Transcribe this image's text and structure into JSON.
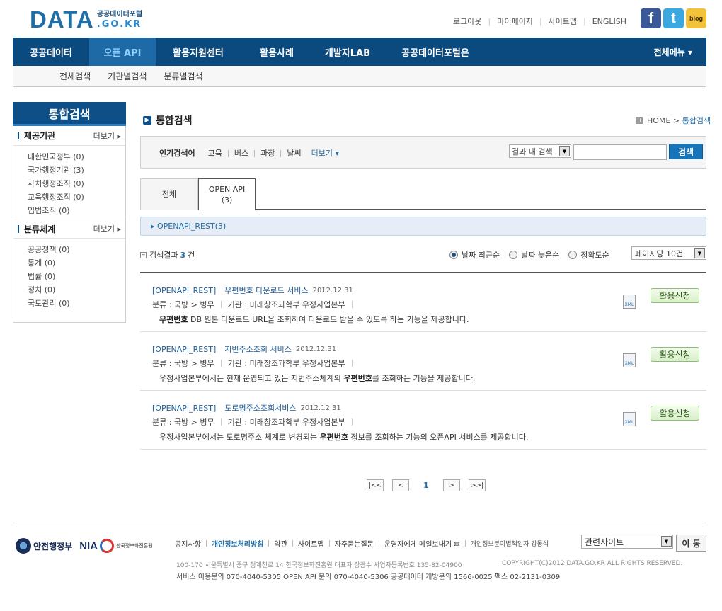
{
  "header": {
    "logo_main": "DATA",
    "logo_sub1": "공공데이터포털",
    "logo_sub2": ".GO.KR",
    "util": [
      "로그아웃",
      "마이페이지",
      "사이트맵",
      "ENGLISH"
    ],
    "social": [
      "f",
      "t",
      "blog"
    ]
  },
  "gnb": {
    "items": [
      "공공데이터",
      "오픈 API",
      "활용지원센터",
      "활용사례",
      "개발자LAB",
      "공공데이터포털은"
    ],
    "active_index": 1,
    "all_menu": "전체메뉴 ▾",
    "sub": [
      "전체검색",
      "기관별검색",
      "분류별검색"
    ]
  },
  "lnb": {
    "title": "통합검색",
    "section1": {
      "label": "제공기관",
      "more": "더보기 ▸",
      "items": [
        "대한민국정부 (0)",
        "국가행정기관 (3)",
        "자치행정조직 (0)",
        "교육행정조직 (0)",
        "입법조직 (0)"
      ]
    },
    "section2": {
      "label": "분류체계",
      "more": "더보기 ▸",
      "items": [
        "공공정책 (0)",
        "통계 (0)",
        "법률 (0)",
        "정치 (0)",
        "국토관리 (0)"
      ]
    }
  },
  "content": {
    "title": "통합검색",
    "breadcrumb_home": "HOME >",
    "breadcrumb_current": "통합검색",
    "popular_label": "인기검색어",
    "popular_keywords": [
      "교육",
      "버스",
      "과장",
      "날씨"
    ],
    "popular_more": "더보기 ▾",
    "within_select": "결과 내 검색",
    "search_value": "",
    "search_button": "검색",
    "tab_all": "전체",
    "tab_api_label": "OPEN API",
    "tab_api_count": "(3)",
    "category_bar": "▸ OPENAPI_REST(3)",
    "result_label": "검색결과",
    "result_count": "3",
    "result_unit": "건",
    "sorts": [
      "날짜 최근순",
      "날짜 늦은순",
      "정확도순"
    ],
    "sort_selected": 0,
    "per_page": "페이지당 10건",
    "apply_label": "활용신청",
    "xml_label": "XML"
  },
  "results": [
    {
      "tag": "[OPENAPI_REST]",
      "title": "우편번호 다운로드 서비스",
      "date": "2012.12.31",
      "category": "분류 : 국방 > 병무",
      "agency": "기관 : 미래창조과학부 우정사업본부",
      "desc_bold": "우편번호",
      "desc": " DB 원본 다운로드 URL을 조회하여 다운로드 받을 수 있도록 하는 기능을 제공합니다."
    },
    {
      "tag": "[OPENAPI_REST]",
      "title": "지번주소조회 서비스",
      "date": "2012.12.31",
      "category": "분류 : 국방 > 병무",
      "agency": "기관 : 미래창조과학부 우정사업본부",
      "desc_pre": "우정사업본부에서는 현재 운영되고 있는 지번주소체계의 ",
      "desc_bold": "우편번호",
      "desc": "를 조회하는 기능을 제공합니다."
    },
    {
      "tag": "[OPENAPI_REST]",
      "title": "도로명주소조회서비스",
      "date": "2012.12.31",
      "category": "분류 : 국방 > 병무",
      "agency": "기관 : 미래창조과학부 우정사업본부",
      "desc_pre": "우정사업본부에서는 도로명주소 체계로 변경되는 ",
      "desc_bold": "우편번호",
      "desc": " 정보를 조회하는 기능의 오픈API 서비스를 제공합니다."
    }
  ],
  "paging": {
    "first": "|<<",
    "prev": "<",
    "current": "1",
    "next": ">",
    "last": ">>|"
  },
  "footer": {
    "mois": "안전행정부",
    "nia": "NIA",
    "nia_sub": "한국정보화진흥원",
    "links": [
      "공지사항",
      "개인정보처리방침",
      "약관",
      "사이트맵",
      "자주묻는질문",
      "운영자에게 메일보내기 ✉",
      "개인정보분야별책임자 강동석"
    ],
    "related": "관련사이트",
    "go": "이 동",
    "address": "100-170  서울특별시 중구 청계천로 14 한국정보화진흥원     대표자 장광수     사업자등록번호 135-82-04900",
    "copyright": "COPYRIGHT(C)2012 DATA.GO.KR ALL RIGHTS RESERVED.",
    "contacts": "서비스 이용문의 070-4040-5305     OPEN API 문의 070-4040-5306     공공데이터 개방문의 1566-0025     팩스 02-2131-0309"
  },
  "colors": {
    "brand": "#0b4a7e",
    "accent": "#1f6ea8",
    "apply_green": "#8bbf73"
  }
}
